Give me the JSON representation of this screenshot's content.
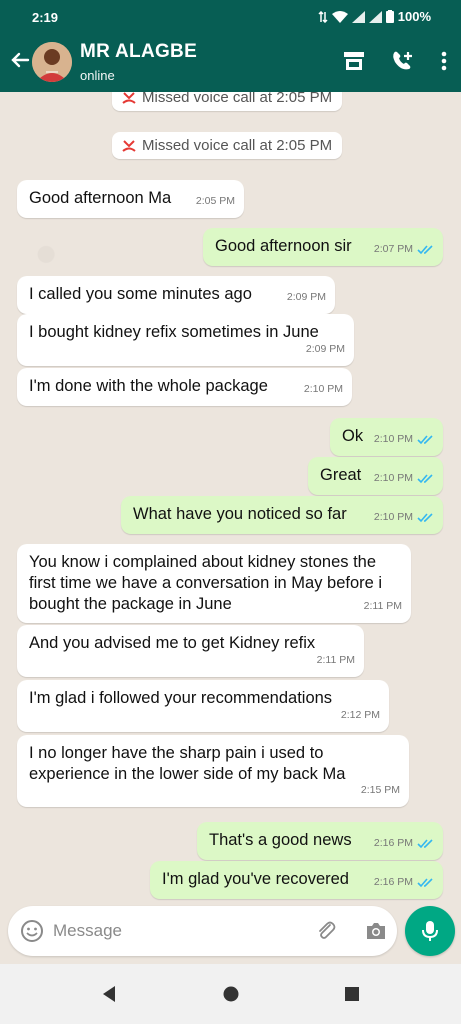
{
  "status": {
    "time": "2:19",
    "battery": "100%"
  },
  "header": {
    "name": "MR ALAGBE",
    "status": "online"
  },
  "system_messages": [
    {
      "text": "Missed voice call at 2:05 PM"
    },
    {
      "text": "Missed voice call at 2:05 PM"
    }
  ],
  "messages": [
    {
      "dir": "in",
      "text": "Good afternoon Ma",
      "time": "2:05 PM"
    },
    {
      "dir": "out",
      "text": "Good afternoon sir",
      "time": "2:07 PM"
    },
    {
      "dir": "in",
      "text": "I called you some minutes ago",
      "time": "2:09 PM"
    },
    {
      "dir": "in",
      "text": "I bought kidney refix sometimes in June",
      "time": "2:09 PM"
    },
    {
      "dir": "in",
      "text": "I'm done with the whole package",
      "time": "2:10 PM"
    },
    {
      "dir": "out",
      "text": "Ok",
      "time": "2:10 PM"
    },
    {
      "dir": "out",
      "text": "Great",
      "time": "2:10 PM"
    },
    {
      "dir": "out",
      "text": "What have you noticed so far",
      "time": "2:10 PM"
    },
    {
      "dir": "in",
      "text": "You know i complained about kidney stones the first time we have a conversation in May before i bought the package in June",
      "time": "2:11 PM"
    },
    {
      "dir": "in",
      "text": "And you advised me to get Kidney refix",
      "time": "2:11 PM"
    },
    {
      "dir": "in",
      "text": "I'm glad i followed your recommendations",
      "time": "2:12 PM"
    },
    {
      "dir": "in",
      "text": "I no longer have the sharp pain i used to experience in the lower side of my back Ma",
      "time": "2:15 PM"
    },
    {
      "dir": "out",
      "text": "That's a good news",
      "time": "2:16 PM"
    },
    {
      "dir": "out",
      "text": "I'm glad you've recovered",
      "time": "2:16 PM"
    }
  ],
  "composer": {
    "placeholder": "Message"
  },
  "colors": {
    "header": "#075e54",
    "outgoing": "#dcf8c6",
    "incoming": "#ffffff",
    "tick": "#34b7f1",
    "fab": "#00a884",
    "missed": "#e53935"
  }
}
